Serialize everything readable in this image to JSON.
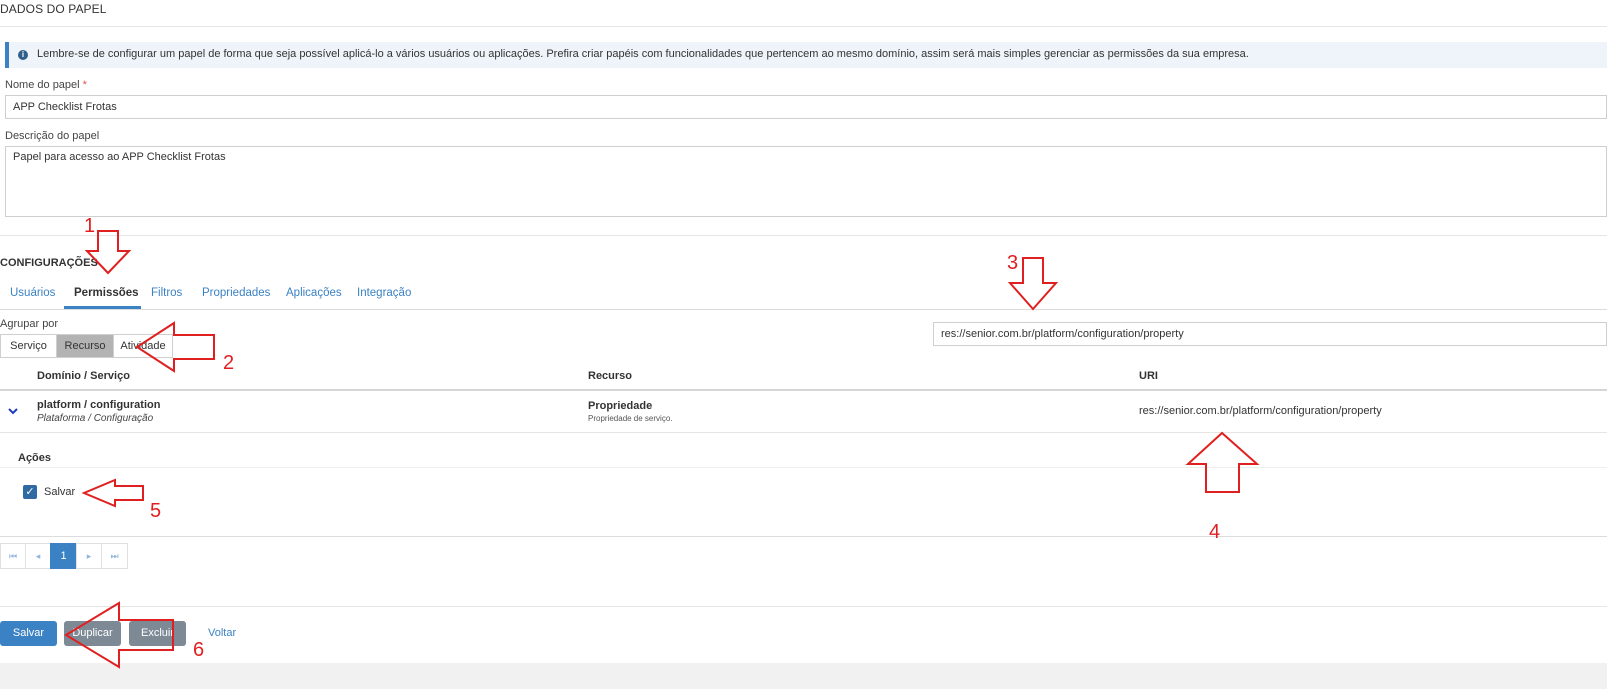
{
  "header": {
    "title": "DADOS DO PAPEL"
  },
  "info_banner": {
    "icon": "info-icon",
    "text": "Lembre-se de configurar um papel de forma que seja possível aplicá-lo a vários usuários ou aplicações. Prefira criar papéis com funcionalidades que pertencem ao mesmo domínio, assim será mais simples gerenciar as permissões da sua empresa."
  },
  "form": {
    "role_name_label": "Nome do papel",
    "required_mark": "*",
    "role_name_value": "APP Checklist Frotas",
    "role_desc_label": "Descrição do papel",
    "role_desc_value": "Papel para acesso ao APP Checklist Frotas"
  },
  "config": {
    "title": "CONFIGURAÇÕES",
    "tabs": [
      "Usuários",
      "Permissões",
      "Filtros",
      "Propriedades",
      "Aplicações",
      "Integração"
    ],
    "active_tab": "Permissões",
    "group_by_label": "Agrupar por",
    "group_by_options": [
      "Serviço",
      "Recurso",
      "Atividade"
    ],
    "group_by_selected": "Recurso",
    "filter_value": "res://senior.com.br/platform/configuration/property"
  },
  "table": {
    "columns": [
      "Domínio / Serviço",
      "Recurso",
      "URI"
    ],
    "rows": [
      {
        "domain": "platform / configuration",
        "domain_sub": "Plataforma / Configuração",
        "resource": "Propriedade",
        "resource_sub": "Propriedade de serviço.",
        "uri": "res://senior.com.br/platform/configuration/property"
      }
    ],
    "actions_label": "Ações",
    "actions": [
      {
        "label": "Salvar",
        "checked": true
      }
    ]
  },
  "pagination": {
    "first_icon": "first-page-icon",
    "prev_icon": "prev-page-icon",
    "current": "1",
    "next_icon": "next-page-icon",
    "last_icon": "last-page-icon"
  },
  "footer": {
    "save_label": "Salvar",
    "duplicate_label": "Duplicar",
    "delete_label": "Excluir",
    "back_label": "Voltar"
  },
  "annotations": {
    "color": "#e02020",
    "numbers": [
      "1",
      "2",
      "3",
      "4",
      "5",
      "6"
    ]
  }
}
